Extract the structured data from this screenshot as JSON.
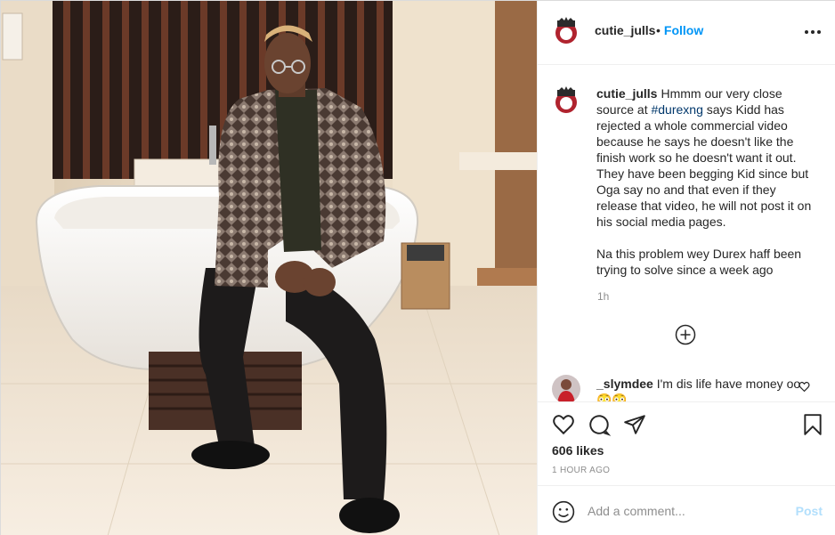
{
  "post": {
    "author": "cutie_julls",
    "follow_label": "Follow",
    "follow_separator": "•",
    "caption_lines_1": "Hmmm our very close source at",
    "hashtag": "#durexng",
    "caption_lines_2": "says Kidd has rejected a whole commercial video because he says he doesn't like the finish work so he doesn't want it out. They have been begging Kid since but Oga say no and that even if they release that video, he will not post it on his social media pages.",
    "caption_para_2": "Na this problem wey Durex haff been trying to solve since a week ago",
    "caption_age": "1h",
    "likes": "606 likes",
    "time_ago": "1 HOUR AGO"
  },
  "comments": [
    {
      "user": "_slymdee",
      "text": "I'm dis life have money oo😳😳"
    }
  ],
  "composer": {
    "placeholder": "Add a comment...",
    "post_label": "Post"
  },
  "icons": {
    "more": "more-horizontal-icon",
    "load_more": "plus-circle-icon",
    "like": "heart-icon",
    "comment": "comment-icon",
    "share": "share-icon",
    "save": "bookmark-icon",
    "emoji": "emoji-icon"
  },
  "colors": {
    "accent": "#0095f6",
    "post_disabled": "#b2dffc",
    "hashtag": "#00376b",
    "muted": "#8e8e8e"
  }
}
